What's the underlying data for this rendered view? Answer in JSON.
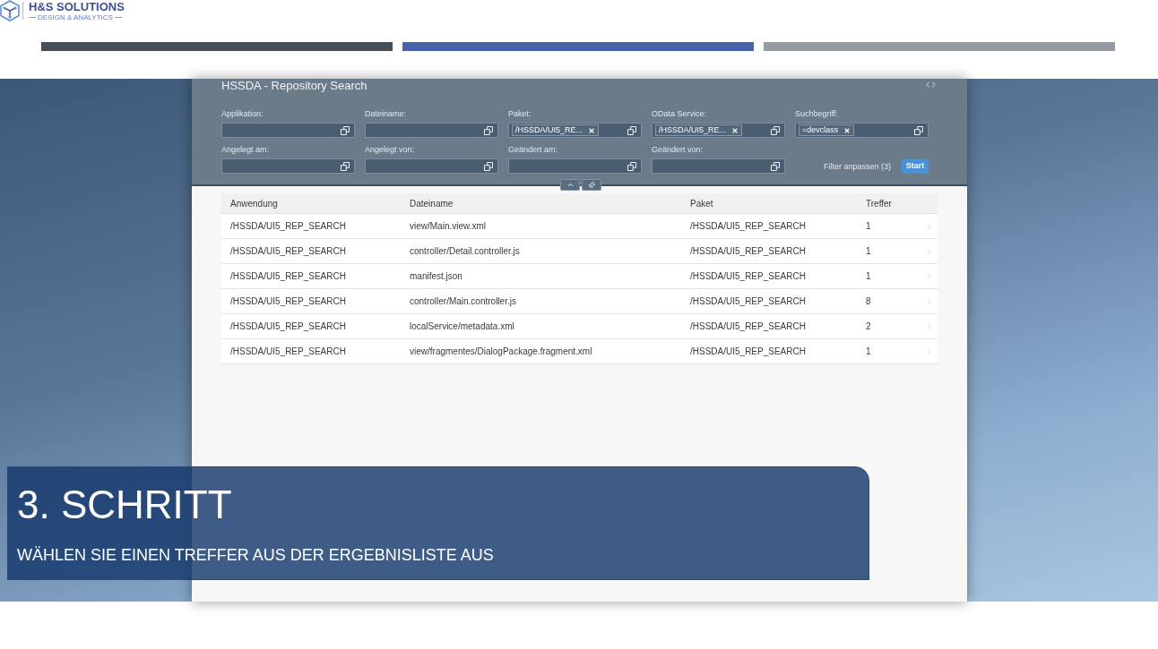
{
  "logo": {
    "name": "H&S SOLUTIONS",
    "tagline": "DESIGN & ANALYTICS"
  },
  "app": {
    "title": "HSSDA - Repository Search",
    "filters": [
      {
        "label": "Applikation:"
      },
      {
        "label": "Dateiname:"
      },
      {
        "label": "Paket:",
        "tokens": [
          "/HSSDA/UI5_RE..."
        ]
      },
      {
        "label": "OData Service:",
        "tokens": [
          "/HSSDA/UI5_RE..."
        ]
      },
      {
        "label": "Suchbegriff:",
        "tokens": [
          "=devclass"
        ]
      },
      {
        "label": "Angelegt am:"
      },
      {
        "label": "Angelegt von:"
      },
      {
        "label": "Geändert am:"
      },
      {
        "label": "Geändert von:"
      }
    ],
    "adapt_filters": "Filter anpassen (3)",
    "start_button": "Start"
  },
  "table": {
    "columns": [
      "Anwendung",
      "Dateiname",
      "Paket",
      "Treffer"
    ],
    "rows": [
      {
        "cells": [
          "/HSSDA/UI5_REP_SEARCH",
          "view/Main.view.xml",
          "/HSSDA/UI5_REP_SEARCH",
          "1"
        ]
      },
      {
        "cells": [
          "/HSSDA/UI5_REP_SEARCH",
          "controller/Detail.controller.js",
          "/HSSDA/UI5_REP_SEARCH",
          "1"
        ]
      },
      {
        "cells": [
          "/HSSDA/UI5_REP_SEARCH",
          "manifest.json",
          "/HSSDA/UI5_REP_SEARCH",
          "1"
        ]
      },
      {
        "cells": [
          "/HSSDA/UI5_REP_SEARCH",
          "controller/Main.controller.js",
          "/HSSDA/UI5_REP_SEARCH",
          "8"
        ]
      },
      {
        "cells": [
          "/HSSDA/UI5_REP_SEARCH",
          "localService/metadata.xml",
          "/HSSDA/UI5_REP_SEARCH",
          "2"
        ]
      },
      {
        "cells": [
          "/HSSDA/UI5_REP_SEARCH",
          "view/fragmentes/DialogPackage.fragment.xml",
          "/HSSDA/UI5_REP_SEARCH",
          "1"
        ]
      }
    ]
  },
  "step": {
    "title": "3. SCHRITT",
    "subtitle": "WÄHLEN SIE EINEN TREFFER AUS DER ERGEBNISLISTE AUS"
  }
}
